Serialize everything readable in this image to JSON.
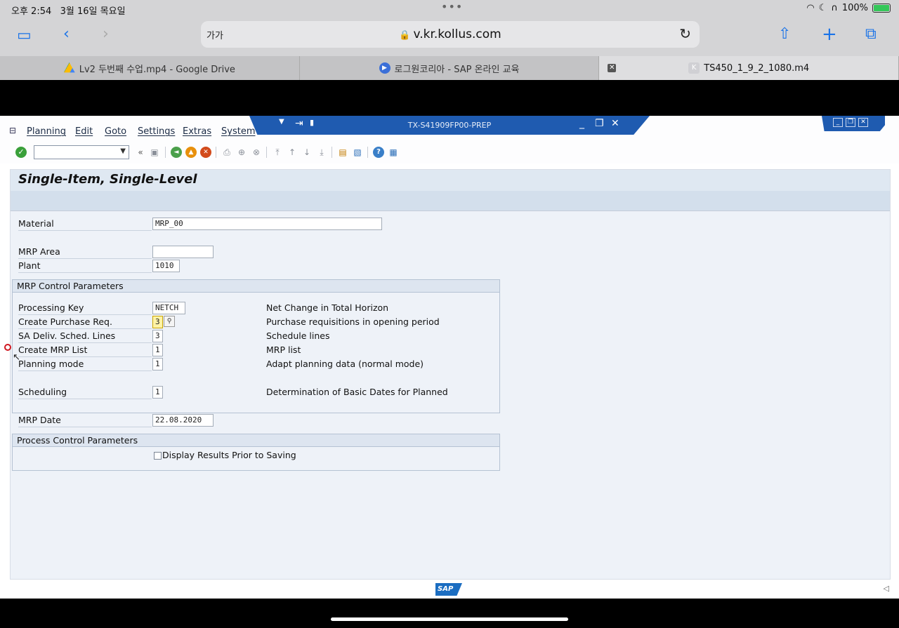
{
  "status_bar": {
    "time": "오후 2:54",
    "date": "3월 16일 목요일",
    "battery": "100%"
  },
  "browser": {
    "aa_label": "가가",
    "url": "v.kr.kollus.com",
    "tabs": [
      {
        "label": "Lv2 두번째 수업.mp4 - Google Drive"
      },
      {
        "label": "로그원코리아 - SAP 온라인 교육"
      },
      {
        "label": "TS450_1_9_2_1080.m4",
        "icon_letter": "K"
      }
    ]
  },
  "sap": {
    "menu": [
      "Planning",
      "Edit",
      "Goto",
      "Settings",
      "Extras",
      "System"
    ],
    "system_title": "TX-S41909FP00-PREP",
    "page_title": "Single-Item, Single-Level",
    "fields": {
      "material_label": "Material",
      "material_value": "MRP_00",
      "mrp_area_label": "MRP Area",
      "mrp_area_value": "",
      "plant_label": "Plant",
      "plant_value": "1010"
    },
    "mrp_control": {
      "header": "MRP Control Parameters",
      "rows": [
        {
          "label": "Processing Key",
          "value": "NETCH",
          "desc": "Net Change in Total Horizon"
        },
        {
          "label": "Create Purchase Req.",
          "value": "3",
          "desc": "Purchase requisitions in opening period"
        },
        {
          "label": "SA Deliv. Sched. Lines",
          "value": "3",
          "desc": "Schedule lines"
        },
        {
          "label": "Create MRP List",
          "value": "1",
          "desc": "MRP list"
        },
        {
          "label": "Planning mode",
          "value": "1",
          "desc": "Adapt planning data (normal mode)"
        },
        {
          "label": "Scheduling",
          "value": "1",
          "desc": "Determination of Basic Dates for Planned"
        },
        {
          "label": "MRP Date",
          "value": "22.08.2020"
        }
      ]
    },
    "process_control": {
      "header": "Process Control Parameters",
      "checkbox_label": "Display Results Prior to Saving"
    },
    "footer_logo": "SAP"
  },
  "colors": {
    "sap_blue": "#1f5bb0",
    "content_bg": "#eef2f8",
    "safari_blue": "#1a73e8"
  }
}
